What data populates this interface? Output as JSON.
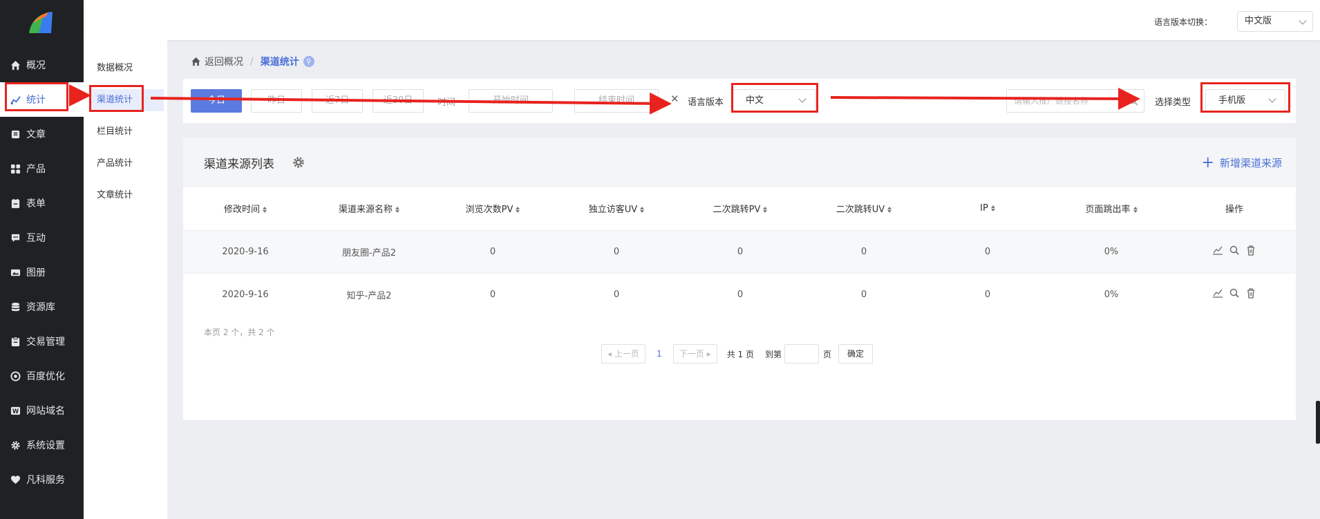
{
  "sidebar": {
    "items": [
      {
        "label": "概况",
        "icon": "home-icon"
      },
      {
        "label": "统计",
        "icon": "stats-icon"
      },
      {
        "label": "文章",
        "icon": "article-icon"
      },
      {
        "label": "产品",
        "icon": "product-icon"
      },
      {
        "label": "表单",
        "icon": "form-icon"
      },
      {
        "label": "互动",
        "icon": "chat-icon"
      },
      {
        "label": "图册",
        "icon": "album-icon"
      },
      {
        "label": "资源库",
        "icon": "database-icon"
      },
      {
        "label": "交易管理",
        "icon": "clipboard-icon"
      },
      {
        "label": "百度优化",
        "icon": "seo-icon"
      },
      {
        "label": "网站域名",
        "icon": "domain-icon"
      },
      {
        "label": "系统设置",
        "icon": "gear-icon"
      },
      {
        "label": "凡科服务",
        "icon": "heart-icon"
      }
    ]
  },
  "subnav": {
    "items": [
      "数据概况",
      "渠道统计",
      "栏目统计",
      "产品统计",
      "文章统计"
    ]
  },
  "topbar": {
    "lang_label": "语言版本切换：",
    "lang_value": "中文版"
  },
  "breadcrumb": {
    "back": "返回概况",
    "sep": "/",
    "current": "渠道统计"
  },
  "filter": {
    "today": "今日",
    "yesterday": "昨日",
    "last7": "近7日",
    "last30": "近30日",
    "time_label": "时间",
    "start_placeholder": "开始时间",
    "end_placeholder": "结束时间",
    "clear": "✕",
    "lang_label": "语言版本",
    "lang_value": "中文",
    "search_placeholder": "请输入推广链接名称",
    "type_label": "选择类型",
    "type_value": "手机版"
  },
  "card": {
    "title": "渠道来源列表",
    "add_label": "新增渠道来源",
    "columns": [
      "修改时间",
      "渠道来源名称",
      "浏览次数PV",
      "独立访客UV",
      "二次跳转PV",
      "二次跳转UV",
      "IP",
      "页面跳出率",
      "操作"
    ],
    "rows": [
      [
        "2020-9-16",
        "朋友圈-产品2",
        "0",
        "0",
        "0",
        "0",
        "0",
        "0%"
      ],
      [
        "2020-9-16",
        "知乎-产品2",
        "0",
        "0",
        "0",
        "0",
        "0",
        "0%"
      ]
    ],
    "page_info": "本页 2 个，共 2 个",
    "pager": {
      "prev": "上一页",
      "current": "1",
      "next": "下一页",
      "total": "共 1 页",
      "goto": "到第",
      "page_unit": "页",
      "ok": "确定"
    }
  },
  "colors": {
    "accent": "#5b7be0",
    "annotation": "#e8231e",
    "sidebar_bg": "#1f2124"
  }
}
